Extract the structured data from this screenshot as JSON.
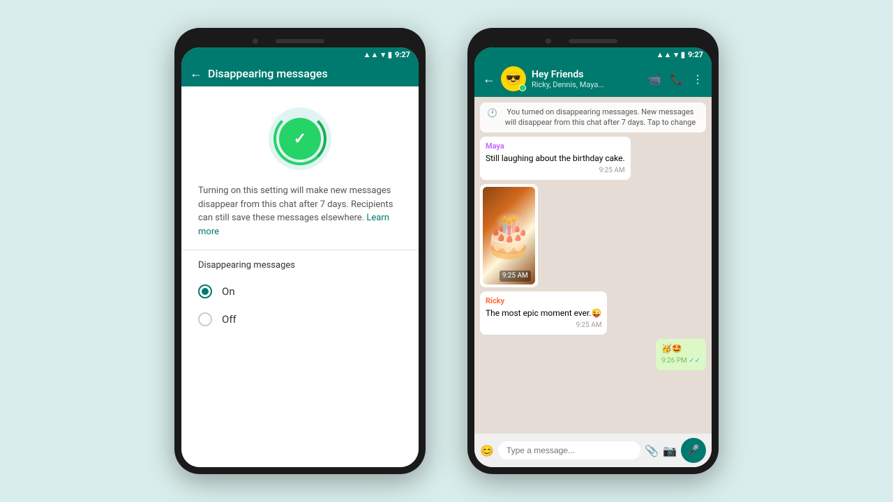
{
  "colors": {
    "whatsapp_green": "#007a6e",
    "message_green": "#dcf8c6",
    "bg": "#d9eeec",
    "phone_dark": "#1a1a1a"
  },
  "left_phone": {
    "status_bar": {
      "time": "9:27"
    },
    "header": {
      "back_label": "←",
      "title": "Disappearing messages"
    },
    "description": "Turning on this setting will make new messages disappear from this chat after 7 days. Recipients can still save these messages elsewhere.",
    "learn_more": "Learn more",
    "section_title": "Disappearing messages",
    "options": [
      {
        "label": "On",
        "selected": true
      },
      {
        "label": "Off",
        "selected": false
      }
    ]
  },
  "right_phone": {
    "status_bar": {
      "time": "9:27"
    },
    "header": {
      "back_label": "←",
      "group_name": "Hey Friends",
      "members": "Ricky, Dennis, Maya...",
      "avatar_emoji": "😎",
      "online_indicator": true
    },
    "system_message": "You turned on disappearing messages. New messages will disappear from this chat after 7 days. Tap to change",
    "messages": [
      {
        "sender": "Maya",
        "sender_color": "maya",
        "text": "Still laughing about the birthday cake.",
        "time": "9:25 AM",
        "type": "incoming"
      },
      {
        "type": "image",
        "sender": null,
        "time": "9:25 AM",
        "has_cake": true
      },
      {
        "sender": "Ricky",
        "sender_color": "ricky",
        "text": "The most epic moment ever.😜",
        "time": "9:25 AM",
        "type": "incoming"
      },
      {
        "sender": null,
        "text": "🥳🤩",
        "time": "9:26 PM",
        "type": "outgoing",
        "ticks": "✓✓"
      }
    ],
    "input_placeholder": "Type a message..."
  }
}
